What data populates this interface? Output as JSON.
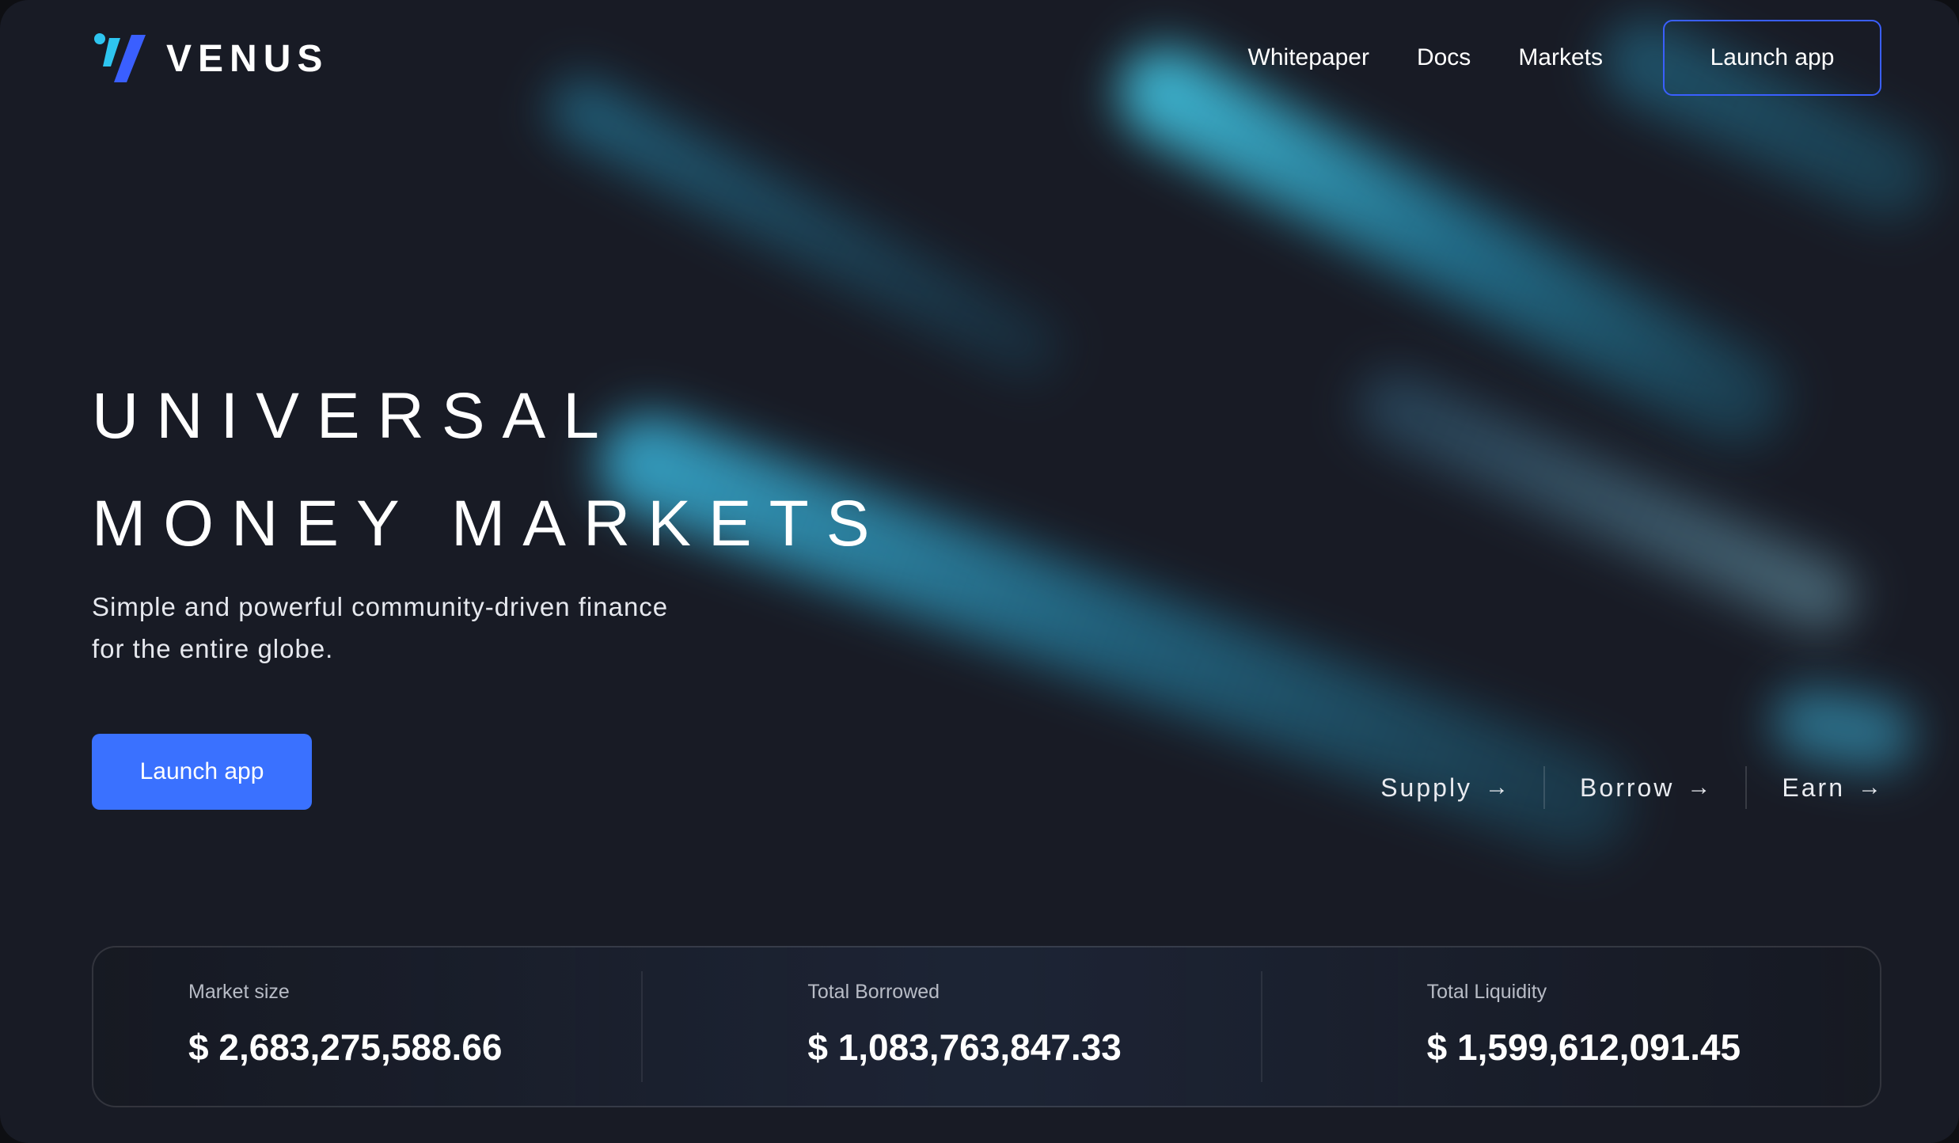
{
  "brand": {
    "name": "VENUS",
    "colors": {
      "accent": "#3a71ff",
      "logo_cyan": "#2ec5f0",
      "logo_blue": "#3a5fff"
    }
  },
  "nav": {
    "links": [
      "Whitepaper",
      "Docs",
      "Markets"
    ],
    "cta_label": "Launch app"
  },
  "hero": {
    "title_line1": "UNIVERSAL",
    "title_line2": "MONEY MARKETS",
    "subtitle_line1": "Simple and powerful community-driven finance",
    "subtitle_line2": "for the entire globe.",
    "cta_label": "Launch app"
  },
  "quick_links": [
    {
      "label": "Supply",
      "icon": "arrow-right-icon",
      "arrow": "→"
    },
    {
      "label": "Borrow",
      "icon": "arrow-right-icon",
      "arrow": "→"
    },
    {
      "label": "Earn",
      "icon": "arrow-right-icon",
      "arrow": "→"
    }
  ],
  "stats": [
    {
      "label": "Market size",
      "value": "$ 2,683,275,588.66"
    },
    {
      "label": "Total Borrowed",
      "value": "$ 1,083,763,847.33"
    },
    {
      "label": "Total Liquidity",
      "value": "$ 1,599,612,091.45"
    }
  ]
}
